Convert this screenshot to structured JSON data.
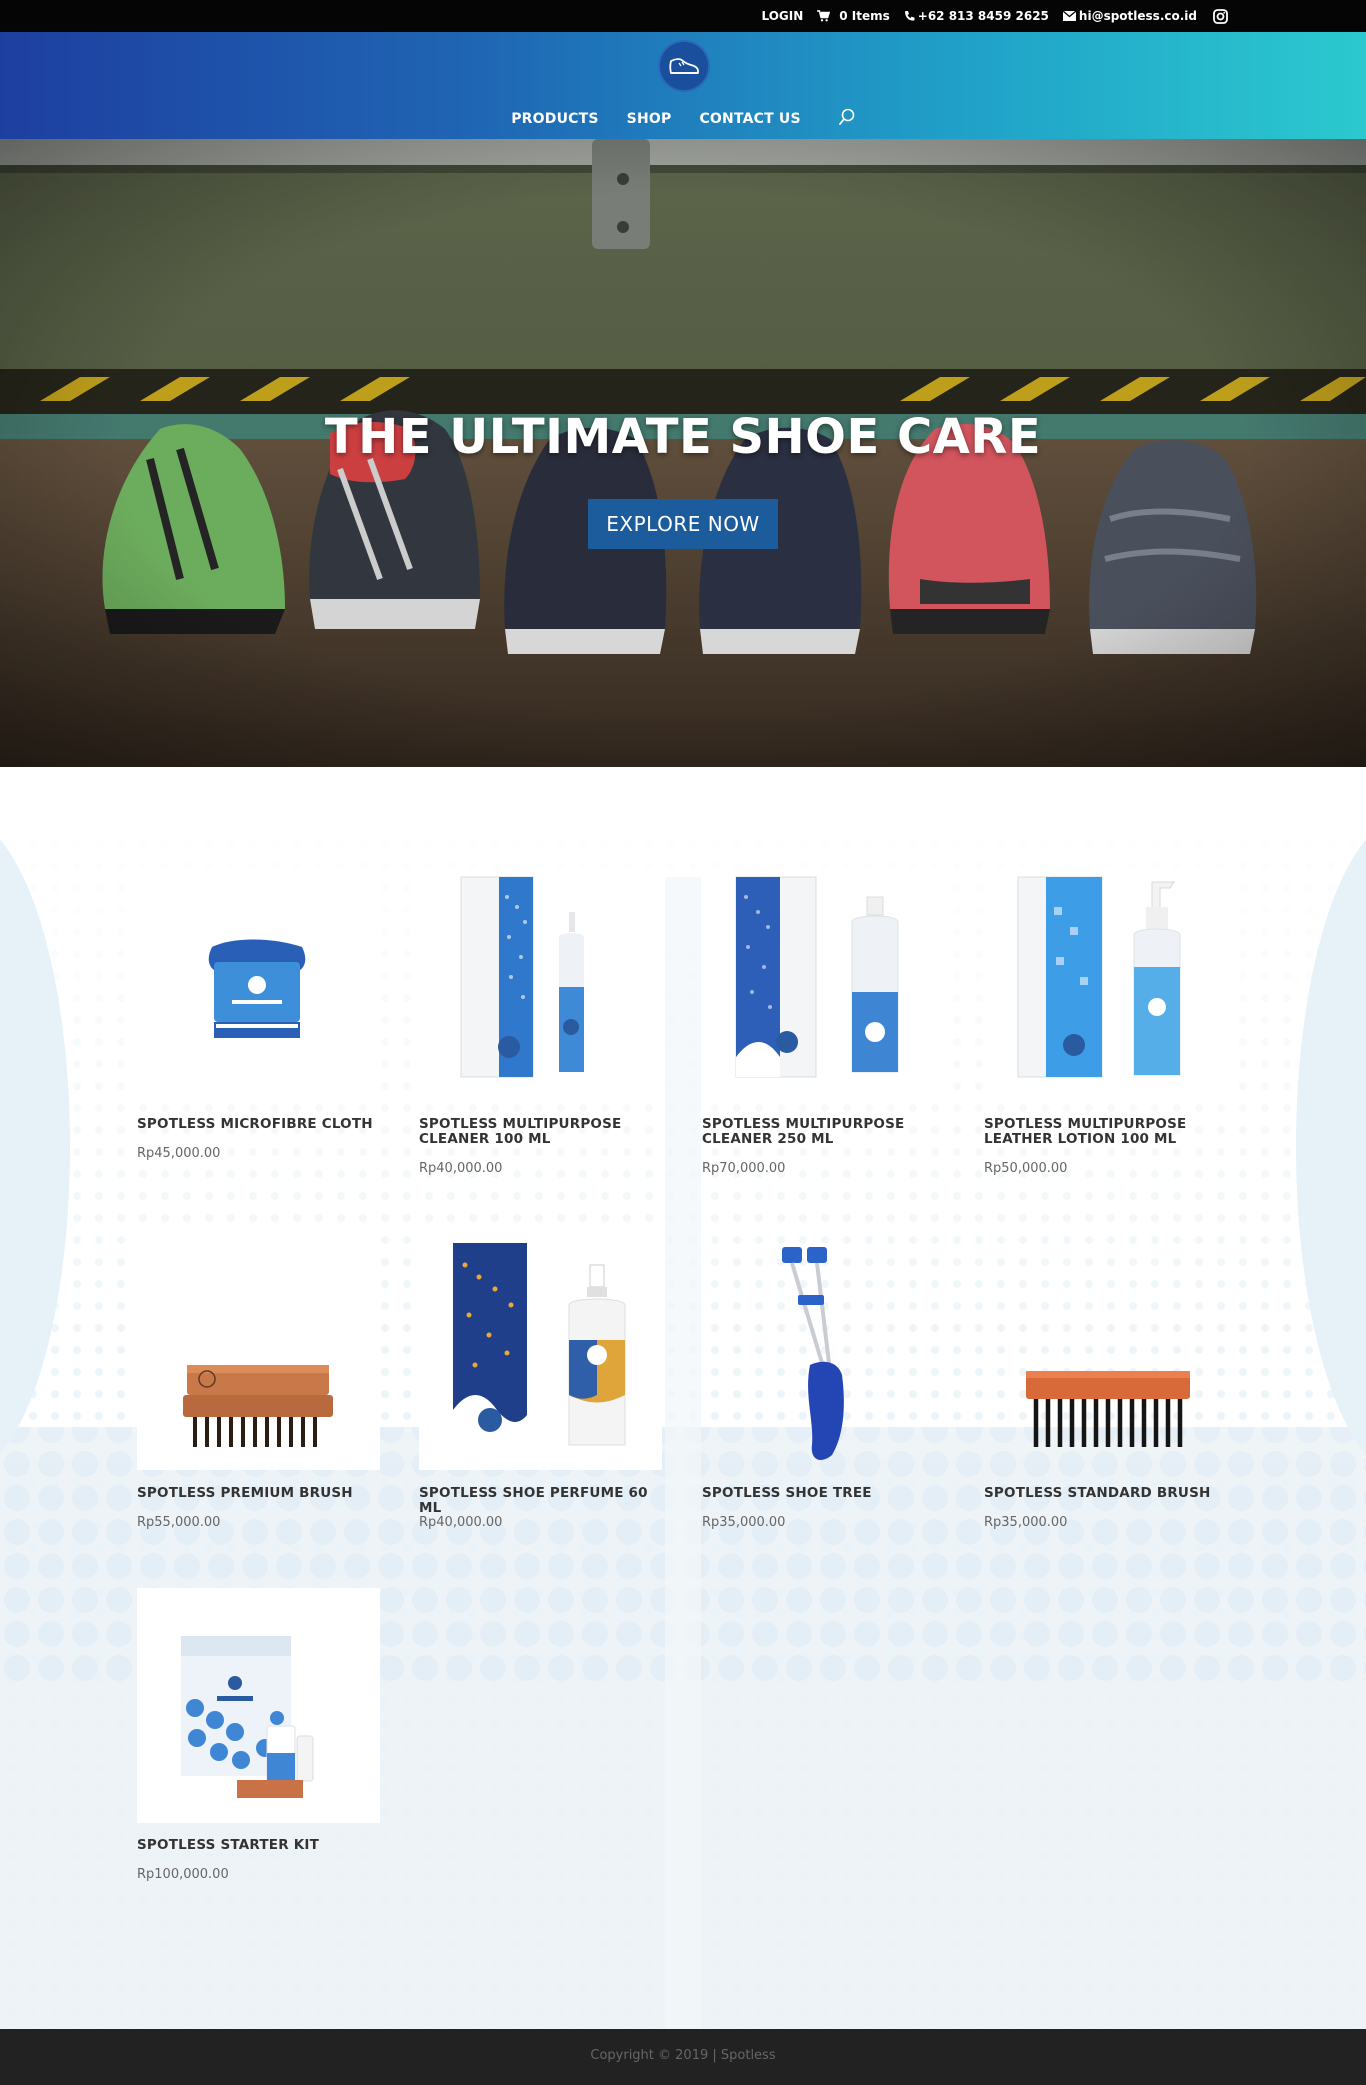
{
  "topbar": {
    "login": "LOGIN",
    "cart": "0 Items",
    "phone": "+62 813 8459 2625",
    "email": "hi@spotless.co.id"
  },
  "nav": {
    "items": [
      {
        "label": "PRODUCTS"
      },
      {
        "label": "SHOP"
      },
      {
        "label": "CONTACT US"
      }
    ]
  },
  "hero": {
    "title": "THE ULTIMATE SHOE CARE",
    "button": "EXPLORE NOW"
  },
  "products": [
    {
      "name": "SPOTLESS MICROFIBRE CLOTH",
      "price": "Rp45,000.00"
    },
    {
      "name": "SPOTLESS MULTIPURPOSE CLEANER 100 ML",
      "price": "Rp40,000.00"
    },
    {
      "name": "SPOTLESS MULTIPURPOSE CLEANER 250 ML",
      "price": "Rp70,000.00"
    },
    {
      "name": "SPOTLESS MULTIPURPOSE LEATHER LOTION 100 ML",
      "price": "Rp50,000.00"
    },
    {
      "name": "SPOTLESS PREMIUM BRUSH",
      "price": "Rp55,000.00"
    },
    {
      "name": "SPOTLESS SHOE PERFUME 60 ML",
      "price": "Rp40,000.00"
    },
    {
      "name": "SPOTLESS SHOE TREE",
      "price": "Rp35,000.00"
    },
    {
      "name": "SPOTLESS STANDARD BRUSH",
      "price": "Rp35,000.00"
    },
    {
      "name": "SPOTLESS STARTER KIT",
      "price": "Rp100,000.00"
    }
  ],
  "footer": {
    "copyright": "Copyright © 2019 | Spotless"
  },
  "colors": {
    "brand_blue": "#1c5b9c",
    "header_start": "#1e3fa0",
    "header_end": "#2bc9cf",
    "footer_bg": "#222222"
  },
  "icons": [
    "cart-icon",
    "phone-icon",
    "mail-icon",
    "instagram-icon",
    "search-icon",
    "shoe-logo-icon"
  ]
}
